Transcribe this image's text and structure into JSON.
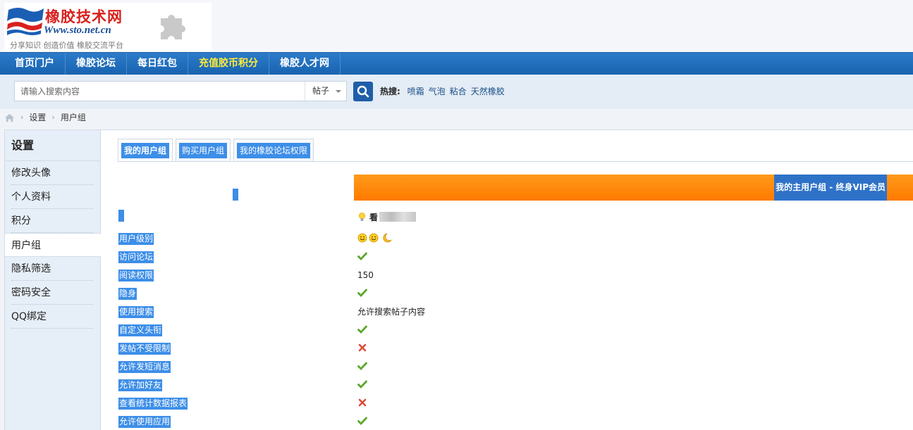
{
  "logo": {
    "name_cn": "橡胶技术网",
    "url": "Www.sto.net.cn",
    "slogan": "分享知识 创造价值 橡胶交流平台"
  },
  "nav": {
    "items": [
      {
        "label": "首页门户",
        "highlight": false
      },
      {
        "label": "橡胶论坛",
        "highlight": false
      },
      {
        "label": "每日红包",
        "highlight": false
      },
      {
        "label": "充值胶币积分",
        "highlight": true
      },
      {
        "label": "橡胶人才网",
        "highlight": false
      }
    ]
  },
  "search": {
    "placeholder": "请输入搜索内容",
    "type": "帖子",
    "hot_label": "热搜:",
    "hot_terms": [
      "喷霜",
      "气泡",
      "粘合",
      "天然橡胶"
    ]
  },
  "breadcrumb": [
    "设置",
    "用户组"
  ],
  "sidebar": {
    "title": "设置",
    "items": [
      "修改头像",
      "个人资料",
      "积分",
      "用户组",
      "隐私筛选",
      "密码安全",
      "QQ绑定"
    ],
    "active_index": 3
  },
  "tabs": [
    "我的用户组",
    "购买用户组",
    "我的橡胶论坛权限"
  ],
  "group": {
    "title": "我的主用户组 - 终身VIP会员",
    "username_initial": "看"
  },
  "permissions": [
    {
      "label": "用户级别",
      "type": "stars"
    },
    {
      "label": "访问论坛",
      "type": "check"
    },
    {
      "label": "阅读权限",
      "type": "text",
      "value": "150"
    },
    {
      "label": "隐身",
      "type": "check"
    },
    {
      "label": "使用搜索",
      "type": "text",
      "value": "允许搜索帖子内容"
    },
    {
      "label": "自定义头衔",
      "type": "check"
    },
    {
      "label": "发帖不受限制",
      "type": "cross"
    },
    {
      "label": "允许发短消息",
      "type": "check"
    },
    {
      "label": "允许加好友",
      "type": "check"
    },
    {
      "label": "查看统计数据报表",
      "type": "cross"
    },
    {
      "label": "允许使用应用",
      "type": "check"
    }
  ],
  "colors": {
    "nav_bg": "#1863b0",
    "highlight": "#ffeb3b",
    "selection": "#3d8ee8",
    "orange": "#ff8a00",
    "check": "#5aa82a",
    "cross": "#e04b3a"
  }
}
